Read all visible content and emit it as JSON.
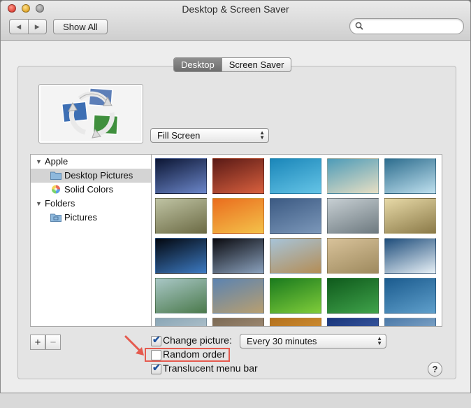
{
  "window": {
    "title": "Desktop & Screen Saver"
  },
  "toolbar": {
    "show_all": "Show All",
    "search_placeholder": ""
  },
  "tabs": [
    {
      "label": "Desktop",
      "active": true
    },
    {
      "label": "Screen Saver",
      "active": false
    }
  ],
  "fill": {
    "selected": "Fill Screen"
  },
  "sidebar": {
    "groups": [
      {
        "label": "Apple",
        "items": [
          {
            "label": "Desktop Pictures",
            "selected": true,
            "icon": "folder-icon"
          },
          {
            "label": "Solid Colors",
            "selected": false,
            "icon": "color-wheel-icon"
          }
        ]
      },
      {
        "label": "Folders",
        "items": [
          {
            "label": "Pictures",
            "selected": false,
            "icon": "pictures-folder-icon"
          }
        ]
      }
    ]
  },
  "thumbnails": [
    {
      "name": "galaxy",
      "c1": "#0c1634",
      "c2": "#6b86c9"
    },
    {
      "name": "canyon",
      "c1": "#5a1a16",
      "c2": "#d9603e"
    },
    {
      "name": "ocean-waves",
      "c1": "#1a86b9",
      "c2": "#65c4e6"
    },
    {
      "name": "beach",
      "c1": "#4d9bb8",
      "c2": "#e7dfc4"
    },
    {
      "name": "frozen-lake",
      "c1": "#2d6d8e",
      "c2": "#bfe0ee"
    },
    {
      "name": "grass",
      "c1": "#bfc3a3",
      "c2": "#6c6b45"
    },
    {
      "name": "autumn-leaves",
      "c1": "#ea6d1e",
      "c2": "#f4c24a"
    },
    {
      "name": "rain-water",
      "c1": "#3c5a83",
      "c2": "#7b97b9"
    },
    {
      "name": "foggy-lake",
      "c1": "#c7cfd3",
      "c2": "#6e7a80"
    },
    {
      "name": "misty-tree",
      "c1": "#e7d9a7",
      "c2": "#8b7a48"
    },
    {
      "name": "earth-horizon",
      "c1": "#03070f",
      "c2": "#3c7ac2"
    },
    {
      "name": "earth-space",
      "c1": "#0b0b10",
      "c2": "#8aa1bd"
    },
    {
      "name": "elephant",
      "c1": "#a7c4d9",
      "c2": "#b48d55"
    },
    {
      "name": "zebras",
      "c1": "#d8c29a",
      "c2": "#9e8a5e"
    },
    {
      "name": "ice-floes",
      "c1": "#1e4d7b",
      "c2": "#e7f0f6"
    },
    {
      "name": "lily-pads",
      "c1": "#a9c7c6",
      "c2": "#4b7a4c"
    },
    {
      "name": "desert-clouds",
      "c1": "#5b83b1",
      "c2": "#b89f70"
    },
    {
      "name": "frog-leaf",
      "c1": "#1a7a1e",
      "c2": "#7fcc3a"
    },
    {
      "name": "green-grass",
      "c1": "#0f5a1c",
      "c2": "#3fa24a"
    },
    {
      "name": "blue-water",
      "c1": "#1b5b8e",
      "c2": "#5f9fcb"
    },
    {
      "name": "row5-a",
      "c1": "#8aa6b6",
      "c2": "#c9d4da"
    },
    {
      "name": "row5-b",
      "c1": "#7c6a55",
      "c2": "#b9a38a"
    },
    {
      "name": "row5-c",
      "c1": "#b4711d",
      "c2": "#e0a142"
    },
    {
      "name": "row5-d",
      "c1": "#19357a",
      "c2": "#4e6fbb"
    },
    {
      "name": "row5-e",
      "c1": "#4b79a8",
      "c2": "#a8c6df"
    }
  ],
  "options": {
    "change_picture_label": "Change picture:",
    "change_picture_checked": true,
    "interval": "Every 30 minutes",
    "random_order_label": "Random order",
    "random_order_checked": false,
    "translucent_label": "Translucent menu bar",
    "translucent_checked": true
  },
  "list_controls": {
    "add": "+",
    "remove": "−"
  },
  "help": "?"
}
